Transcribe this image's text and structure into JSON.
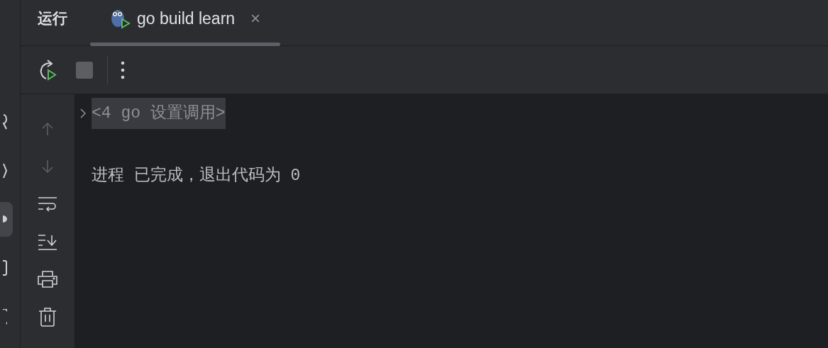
{
  "sidebar": {
    "items": [
      {
        "selected": false
      },
      {
        "selected": false
      },
      {
        "selected": true
      },
      {
        "selected": false
      },
      {
        "selected": false
      }
    ]
  },
  "tool_window": {
    "title": "运行",
    "tabs": [
      {
        "label": "go build learn",
        "selected": true,
        "close": "×"
      }
    ]
  },
  "gutter": [
    {
      "kind": "up",
      "disabled": true
    },
    {
      "kind": "down",
      "disabled": true
    },
    {
      "kind": "wrap",
      "disabled": false
    },
    {
      "kind": "scroll-end",
      "disabled": false
    },
    {
      "kind": "print",
      "disabled": false
    },
    {
      "kind": "delete",
      "disabled": false
    }
  ],
  "console": {
    "fold": {
      "label": "<4 go 设置调用>",
      "expanded": false
    },
    "lines": [
      "进程 已完成，退出代码为 0"
    ]
  }
}
